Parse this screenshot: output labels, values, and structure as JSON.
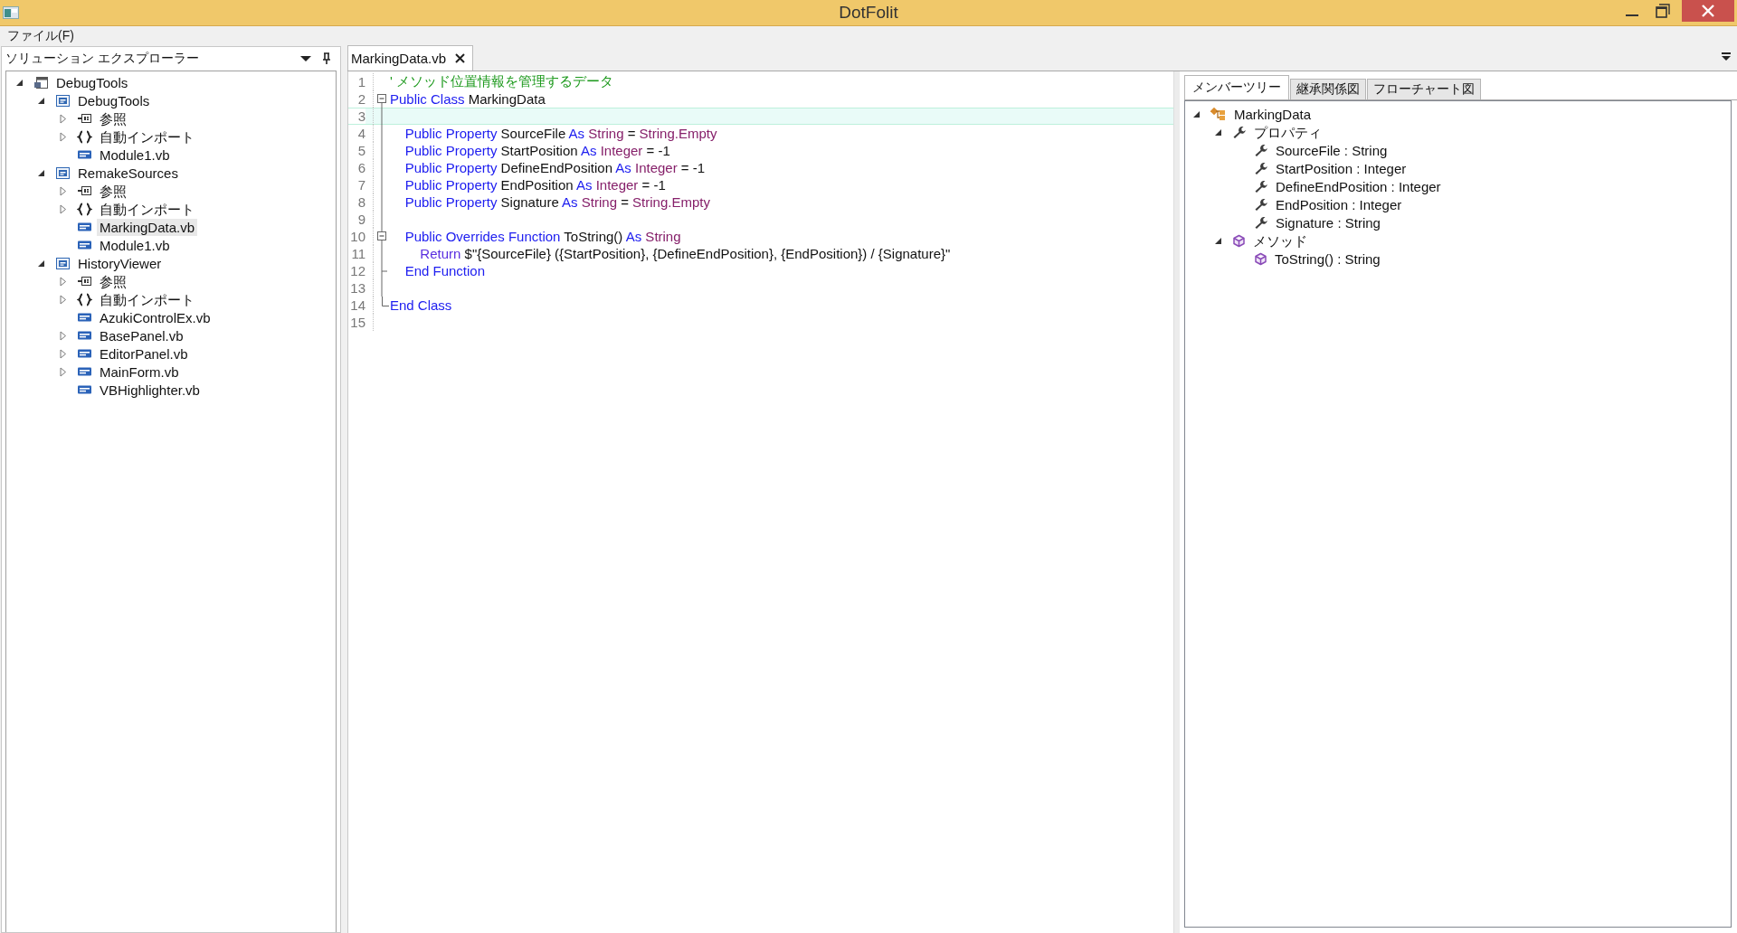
{
  "window": {
    "title": "DotFolit"
  },
  "menu": [
    {
      "label": "ファイル(F)"
    }
  ],
  "explorer": {
    "title": "ソリューション エクスプローラー",
    "tree": [
      {
        "label": "DebugTools",
        "kind": "solution",
        "expanded": true,
        "selected": false,
        "children": [
          {
            "label": "DebugTools",
            "kind": "project",
            "expanded": true,
            "selected": false,
            "children": [
              {
                "label": "参照",
                "kind": "references",
                "expanded": false,
                "selected": false
              },
              {
                "label": "自動インポート",
                "kind": "imports",
                "expanded": false,
                "selected": false
              },
              {
                "label": "Module1.vb",
                "kind": "vb",
                "selected": false
              }
            ]
          },
          {
            "label": "RemakeSources",
            "kind": "project",
            "expanded": true,
            "selected": false,
            "children": [
              {
                "label": "参照",
                "kind": "references",
                "expanded": false,
                "selected": false
              },
              {
                "label": "自動インポート",
                "kind": "imports",
                "expanded": false,
                "selected": false
              },
              {
                "label": "MarkingData.vb",
                "kind": "vb",
                "selected": true
              },
              {
                "label": "Module1.vb",
                "kind": "vb",
                "selected": false
              }
            ]
          },
          {
            "label": "HistoryViewer",
            "kind": "project",
            "expanded": true,
            "selected": false,
            "children": [
              {
                "label": "参照",
                "kind": "references",
                "expanded": false,
                "selected": false
              },
              {
                "label": "自動インポート",
                "kind": "imports",
                "expanded": false,
                "selected": false
              },
              {
                "label": "AzukiControlEx.vb",
                "kind": "vb",
                "selected": false
              },
              {
                "label": "BasePanel.vb",
                "kind": "vb",
                "expanded": false,
                "selected": false
              },
              {
                "label": "EditorPanel.vb",
                "kind": "vb",
                "expanded": false,
                "selected": false
              },
              {
                "label": "MainForm.vb",
                "kind": "vb",
                "expanded": false,
                "selected": false
              },
              {
                "label": "VBHighlighter.vb",
                "kind": "vb",
                "selected": false
              }
            ]
          }
        ]
      }
    ]
  },
  "editor": {
    "tabs": [
      {
        "label": "MarkingData.vb",
        "selected": true
      }
    ],
    "lines": [
      {
        "number": "1",
        "kind": "plain",
        "current": false,
        "tokens": [
          {
            "kind": "comment",
            "text": "' メソッド位置情報を管理するデータ"
          }
        ]
      },
      {
        "number": "2",
        "kind": "fold_start",
        "current": false,
        "tokens": [
          {
            "kind": "keyword",
            "text": "Public Class"
          },
          {
            "kind": "plain",
            "text": " MarkingData"
          }
        ]
      },
      {
        "number": "3",
        "kind": "body",
        "current": true
      },
      {
        "number": "4",
        "kind": "body",
        "current": false,
        "tokens": [
          {
            "kind": "keyword",
            "text": "    Public Property"
          },
          {
            "kind": "plain",
            "text": " SourceFile "
          },
          {
            "kind": "keyword",
            "text": "As"
          },
          {
            "kind": "type",
            "text": " String"
          },
          {
            "kind": "plain",
            "text": " = "
          },
          {
            "kind": "type",
            "text": "String.Empty"
          }
        ]
      },
      {
        "number": "5",
        "kind": "body",
        "current": false,
        "tokens": [
          {
            "kind": "keyword",
            "text": "    Public Property"
          },
          {
            "kind": "plain",
            "text": " StartPosition "
          },
          {
            "kind": "keyword",
            "text": "As"
          },
          {
            "kind": "type",
            "text": " Integer"
          },
          {
            "kind": "plain",
            "text": " = -1"
          }
        ]
      },
      {
        "number": "6",
        "kind": "body",
        "current": false,
        "tokens": [
          {
            "kind": "keyword",
            "text": "    Public Property"
          },
          {
            "kind": "plain",
            "text": " DefineEndPosition "
          },
          {
            "kind": "keyword",
            "text": "As"
          },
          {
            "kind": "type",
            "text": " Integer"
          },
          {
            "kind": "plain",
            "text": " = -1"
          }
        ]
      },
      {
        "number": "7",
        "kind": "body",
        "current": false,
        "tokens": [
          {
            "kind": "keyword",
            "text": "    Public Property"
          },
          {
            "kind": "plain",
            "text": " EndPosition "
          },
          {
            "kind": "keyword",
            "text": "As"
          },
          {
            "kind": "type",
            "text": " Integer"
          },
          {
            "kind": "plain",
            "text": " = -1"
          }
        ]
      },
      {
        "number": "8",
        "kind": "body",
        "current": false,
        "tokens": [
          {
            "kind": "keyword",
            "text": "    Public Property"
          },
          {
            "kind": "plain",
            "text": " Signature "
          },
          {
            "kind": "keyword",
            "text": "As"
          },
          {
            "kind": "type",
            "text": " String"
          },
          {
            "kind": "plain",
            "text": " = "
          },
          {
            "kind": "type",
            "text": "String.Empty"
          }
        ]
      },
      {
        "number": "9",
        "kind": "body",
        "current": false
      },
      {
        "number": "10",
        "kind": "fold_start",
        "current": false,
        "tokens": [
          {
            "kind": "keyword",
            "text": "    Public Overrides Function"
          },
          {
            "kind": "plain",
            "text": " ToString() "
          },
          {
            "kind": "keyword",
            "text": "As"
          },
          {
            "kind": "type",
            "text": " String"
          }
        ]
      },
      {
        "number": "11",
        "kind": "body",
        "current": false,
        "tokens": [
          {
            "kind": "control",
            "text": "        Return"
          },
          {
            "kind": "plain",
            "text": " $\"{SourceFile} ({StartPosition}, {DefineEndPosition}, {EndPosition}) / {Signature}\""
          }
        ]
      },
      {
        "number": "12",
        "kind": "fold_inner_end",
        "current": false,
        "tokens": [
          {
            "kind": "keyword",
            "text": "    End Function"
          }
        ]
      },
      {
        "number": "13",
        "kind": "body",
        "current": false
      },
      {
        "number": "14",
        "kind": "fold_end",
        "current": false,
        "tokens": [
          {
            "kind": "keyword",
            "text": "End Class"
          }
        ]
      },
      {
        "number": "15",
        "kind": "plain",
        "current": false
      }
    ]
  },
  "members": {
    "tabs": [
      {
        "label": "メンバーツリー",
        "selected": true
      },
      {
        "label": "継承関係図",
        "selected": false
      },
      {
        "label": "フローチャート図",
        "selected": false
      }
    ],
    "tree": [
      {
        "label": "MarkingData",
        "kind": "class",
        "expanded": true,
        "children": [
          {
            "label": "プロパティ",
            "kind": "property",
            "expanded": true,
            "children": [
              {
                "label": "SourceFile : String",
                "kind": "property"
              },
              {
                "label": "StartPosition : Integer",
                "kind": "property"
              },
              {
                "label": "DefineEndPosition : Integer",
                "kind": "property"
              },
              {
                "label": "EndPosition : Integer",
                "kind": "property"
              },
              {
                "label": "Signature : String",
                "kind": "property"
              }
            ]
          },
          {
            "label": "メソッド",
            "kind": "method",
            "expanded": true,
            "children": [
              {
                "label": "ToString() : String",
                "kind": "method"
              }
            ]
          }
        ]
      }
    ]
  }
}
